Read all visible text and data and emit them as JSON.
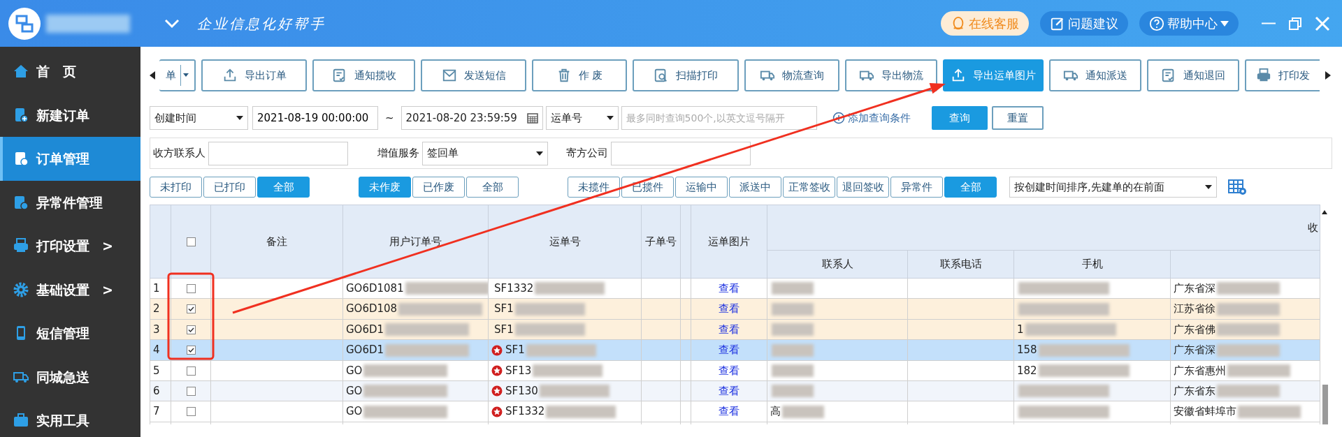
{
  "app": {
    "tagline": "企业信息化好帮手"
  },
  "header_buttons": [
    {
      "label": "在线客服",
      "kind": "service"
    },
    {
      "label": "问题建议",
      "kind": "feedback"
    },
    {
      "label": "帮助中心",
      "kind": "help"
    }
  ],
  "sidebar": {
    "items": [
      {
        "label": "首　页",
        "kind": "home",
        "selected": false
      },
      {
        "label": "新建订单",
        "kind": "new",
        "selected": false
      },
      {
        "label": "订单管理",
        "kind": "orders",
        "selected": true
      },
      {
        "label": "异常件管理",
        "kind": "exception",
        "selected": false
      },
      {
        "label": "打印设置",
        "kind": "print",
        "selected": false,
        "arrow": ">"
      },
      {
        "label": "基础设置",
        "kind": "gear",
        "selected": false,
        "arrow": ">"
      },
      {
        "label": "短信管理",
        "kind": "phone",
        "selected": false
      },
      {
        "label": "同城急送",
        "kind": "truck",
        "selected": false
      },
      {
        "label": "实用工具",
        "kind": "tools",
        "selected": false
      }
    ]
  },
  "toolbar": {
    "buttons": [
      {
        "label": "单",
        "kind": "split",
        "selected": false
      },
      {
        "label": "导出订单",
        "kind": "upload",
        "selected": false
      },
      {
        "label": "通知揽收",
        "kind": "notice",
        "selected": false
      },
      {
        "label": "发送短信",
        "kind": "mail",
        "selected": false
      },
      {
        "label": "作 废",
        "kind": "trash",
        "selected": false
      },
      {
        "label": "扫描打印",
        "kind": "scan",
        "selected": false
      },
      {
        "label": "物流查询",
        "kind": "truck",
        "selected": false
      },
      {
        "label": "导出物流",
        "kind": "truck",
        "selected": false
      },
      {
        "label": "导出运单图片",
        "kind": "upload",
        "selected": true
      },
      {
        "label": "通知派送",
        "kind": "truck",
        "selected": false
      },
      {
        "label": "通知退回",
        "kind": "notice",
        "selected": false
      },
      {
        "label": "打印发",
        "kind": "print",
        "selected": false
      }
    ]
  },
  "filters": {
    "date_field": "创建时间",
    "start": "2021-08-19 00:00:00",
    "separator": "~",
    "end": "2021-08-20 23:59:59",
    "number_field": "运单号",
    "search_placeholder": "最多同时查询500个,以英文逗号隔开",
    "add_condition": "添加查询条件",
    "query": "查询",
    "reset": "重置",
    "receiver_label": "收方联系人",
    "service_label": "增值服务",
    "service_value": "签回单",
    "sender_label": "寄方公司"
  },
  "status_groups": [
    [
      {
        "label": "未打印",
        "selected": false
      },
      {
        "label": "已打印",
        "selected": false
      },
      {
        "label": "全部",
        "selected": true
      }
    ],
    [
      {
        "label": "未作废",
        "selected": true
      },
      {
        "label": "已作废",
        "selected": false
      },
      {
        "label": "全部",
        "selected": false
      }
    ],
    [
      {
        "label": "未揽件",
        "selected": false
      },
      {
        "label": "已揽件",
        "selected": false
      },
      {
        "label": "运输中",
        "selected": false
      },
      {
        "label": "派送中",
        "selected": false
      },
      {
        "label": "正常签收",
        "selected": false
      },
      {
        "label": "退回签收",
        "selected": false
      },
      {
        "label": "异常件",
        "selected": false
      },
      {
        "label": "全部",
        "selected": true
      }
    ]
  ],
  "sort": "按创建时间排序,先建单的在前面",
  "table": {
    "select_all_checked": false,
    "columns": [
      "备注",
      "用户订单号",
      "运单号",
      "子单号",
      "运单图片"
    ],
    "group": "收",
    "sub_columns": [
      "联系人",
      "联系电话",
      "手机"
    ],
    "rows": [
      {
        "index": "1",
        "checked": false,
        "current": false,
        "order_no": "GO6D1081",
        "star": false,
        "waybill": "SF1332",
        "image": "查看",
        "address": "广东省深"
      },
      {
        "index": "2",
        "checked": true,
        "current": false,
        "order_no": "GO6D108",
        "star": false,
        "waybill": "SF1",
        "image": "查看",
        "address": "江苏省徐"
      },
      {
        "index": "3",
        "checked": true,
        "current": false,
        "order_no": "GO6D1",
        "star": false,
        "waybill": "SF1",
        "image": "查看",
        "phone": "1",
        "address": "广东省佛"
      },
      {
        "index": "4",
        "checked": true,
        "current": true,
        "order_no": "GO6D1",
        "star": true,
        "waybill": "SF1",
        "image": "查看",
        "phone": "158",
        "address": "广东省深"
      },
      {
        "index": "5",
        "checked": false,
        "current": false,
        "order_no": "GO",
        "star": true,
        "waybill": "SF13",
        "image": "查看",
        "phone": "182",
        "address": "广东省惠州"
      },
      {
        "index": "6",
        "checked": false,
        "current": false,
        "order_no": "GO",
        "star": true,
        "waybill": "SF130",
        "image": "查看",
        "address": "广东省东"
      },
      {
        "index": "7",
        "checked": false,
        "current": false,
        "order_no": "GO",
        "star": true,
        "waybill": "SF1332",
        "image": "查看",
        "contact": "高",
        "address": "安徽省蚌埠市"
      }
    ]
  }
}
